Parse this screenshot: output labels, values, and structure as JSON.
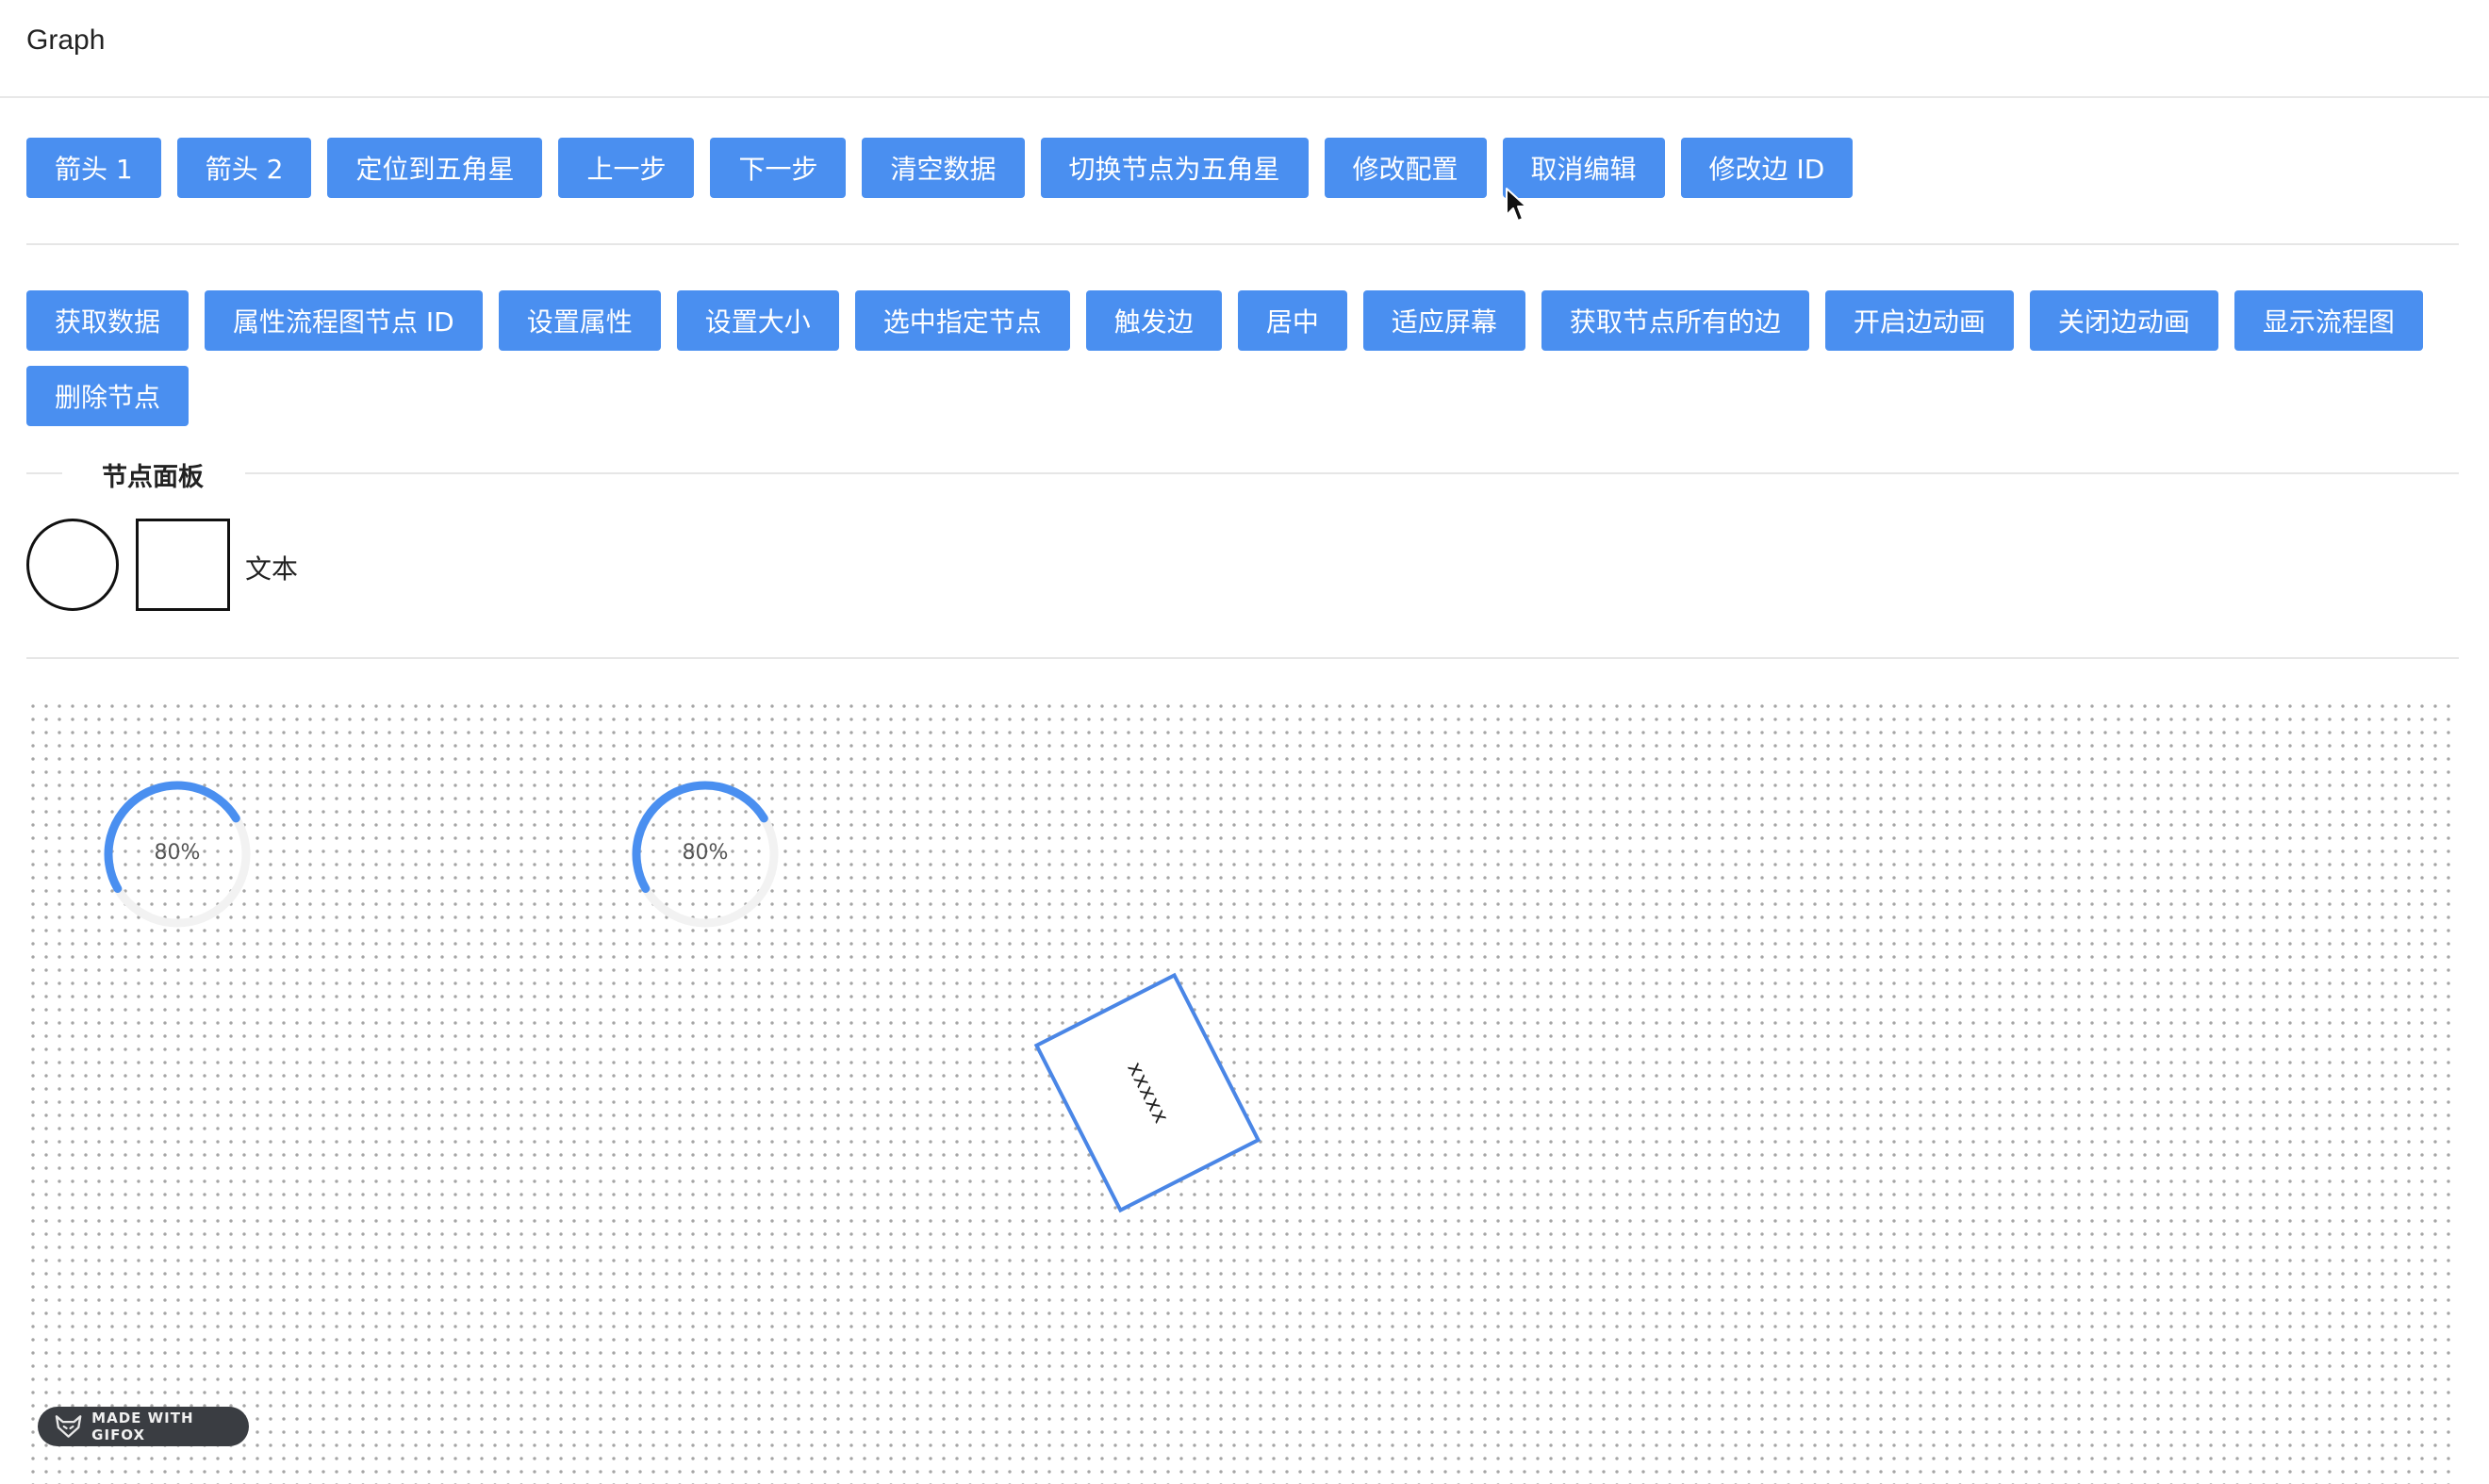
{
  "header": {
    "title": "Graph"
  },
  "toolbar1": {
    "buttons": [
      "箭头 1",
      "箭头 2",
      "定位到五角星",
      "上一步",
      "下一步",
      "清空数据",
      "切换节点为五角星",
      "修改配置",
      "取消编辑",
      "修改边 ID"
    ]
  },
  "toolbar2": {
    "buttons": [
      "获取数据",
      "属性流程图节点 ID",
      "设置属性",
      "设置大小",
      "选中指定节点",
      "触发边",
      "居中",
      "适应屏幕",
      "获取节点所有的边",
      "开启边动画",
      "关闭边动画",
      "显示流程图",
      "删除节点"
    ]
  },
  "node_panel": {
    "title": "节点面板",
    "items": [
      {
        "name": "circle",
        "icon": "circle-shape-icon"
      },
      {
        "name": "rect",
        "icon": "rect-shape-icon"
      },
      {
        "name": "text",
        "label": "文本"
      }
    ]
  },
  "canvas": {
    "gauges": [
      {
        "label": "80%",
        "value": 0.8
      },
      {
        "label": "80%",
        "value": 0.8
      }
    ],
    "rect_node": {
      "text": "xxxxx"
    }
  },
  "watermark": {
    "text": "MADE WITH GIFOX",
    "icon": "fox-icon"
  },
  "colors": {
    "button_bg": "#4a8ff0",
    "button_text": "#ffffff",
    "accent": "#4a86e6",
    "divider": "#e6e6e6"
  }
}
